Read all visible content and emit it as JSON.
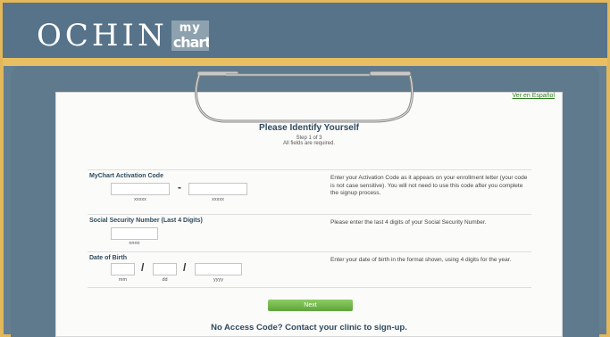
{
  "header": {
    "logo_ochin": "OCHIN",
    "logo_my": "my",
    "logo_chart": "chart"
  },
  "page": {
    "spanish_link": "Ver en Español",
    "title": "Please Identify Yourself",
    "step": "Step 1 of 3",
    "required_note": "All fields are required."
  },
  "activation": {
    "label": "MyChart Activation Code",
    "placeholder_1": "xxxxx",
    "placeholder_2": "xxxxx",
    "separator": "-",
    "help": "Enter your Activation Code as it appears on your enrollment letter (your code is not case sensitive). You will not need to use this code after you complete the signup process."
  },
  "ssn": {
    "label": "Social Security Number (Last 4 Digits)",
    "placeholder": "nnnn",
    "help": "Please enter the last 4 digits of your Social Security Number."
  },
  "dob": {
    "label": "Date of Birth",
    "mm": "mm",
    "dd": "dd",
    "yyyy": "yyyy",
    "slash": "/",
    "help": "Enter your date of birth in the format shown, using 4 digits for the year."
  },
  "actions": {
    "next": "Next"
  },
  "footer": {
    "message": "No Access Code? Contact your clinic to sign-up."
  },
  "colors": {
    "accent_border": "#e2b85a",
    "header_bg": "#56738a",
    "button_green": "#6fb44a"
  }
}
